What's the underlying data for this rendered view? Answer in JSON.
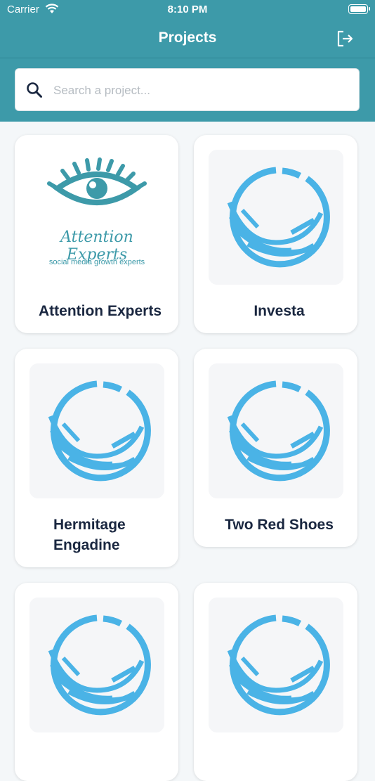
{
  "status_bar": {
    "carrier": "Carrier",
    "time": "8:10 PM"
  },
  "header": {
    "title": "Projects"
  },
  "search": {
    "placeholder": "Search a project..."
  },
  "projects": [
    {
      "name": "Attention Experts",
      "logo_wordmark": "Attention Experts",
      "logo_tagline": "social media growth experts"
    },
    {
      "name": "Investa"
    },
    {
      "name": "Hermitage Engadine"
    },
    {
      "name": "Two Red Shoes"
    },
    {
      "name": ""
    },
    {
      "name": ""
    }
  ],
  "colors": {
    "header": "#3d9aa9",
    "logo_blue": "#4ab3e6",
    "eye_teal": "#3d9aa9",
    "card_text": "#1a2740"
  }
}
